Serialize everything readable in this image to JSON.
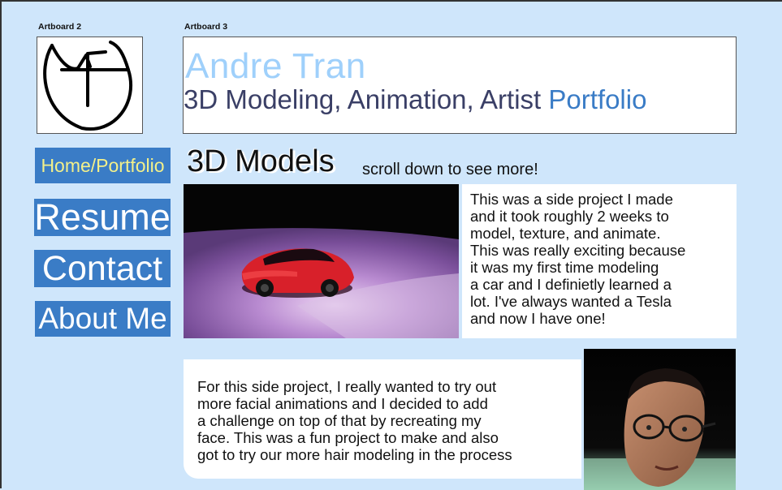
{
  "artboards": {
    "left_label": "Artboard 2",
    "right_label": "Artboard 3"
  },
  "header": {
    "name": "Andre Tran",
    "subtitle_main": "3D Modeling, Animation, Artist ",
    "subtitle_accent": "Portfolio"
  },
  "nav": {
    "home": "Home/Portfolio",
    "resume": "Resume",
    "contact": "Contact",
    "about": "About Me"
  },
  "section": {
    "title": "3D Models",
    "hint": "scroll down to see more!"
  },
  "projects": [
    {
      "description_lines": [
        "This was a side project I made",
        "and it took roughly 2 weeks to",
        "model, texture, and animate.",
        "This was really exciting because",
        "it was my first time modeling",
        "a car and I definietly learned a",
        "lot. I've always wanted a Tesla",
        "and now I have one!"
      ],
      "image": "red-tesla-render"
    },
    {
      "description_lines": [
        "For this side project, I really wanted to try out",
        "more facial animations and I decided to add",
        "a challenge on top of that by recreating my",
        "face. This was a fun project to make and also",
        "got to try our more hair modeling in the process"
      ],
      "image": "face-model-render"
    }
  ],
  "colors": {
    "background": "#cfe6fb",
    "nav_button": "#3a7cc6",
    "home_text": "#f3f08a",
    "name_text": "#9fd0fb",
    "subtitle_text": "#3a3f66"
  }
}
